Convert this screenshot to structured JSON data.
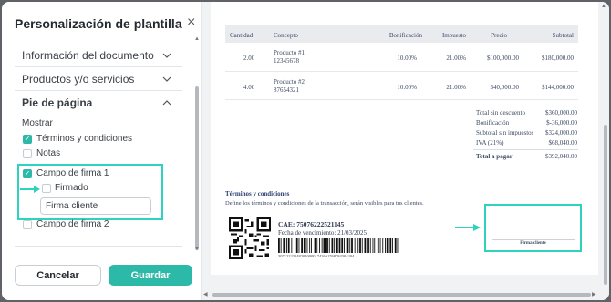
{
  "panel": {
    "title": "Personalización de plantilla",
    "close": "×",
    "sections": [
      {
        "label": "Información del documento",
        "chevron": "⌄"
      },
      {
        "label": "Productos y/o servicios",
        "chevron": "⌄"
      },
      {
        "label": "Pie de página",
        "chevron": "⌃"
      }
    ],
    "footer": {
      "heading": "Mostrar",
      "terms": "Términos y condiciones",
      "notes": "Notas",
      "sig1": "Campo de firma 1",
      "signed": "Firmado",
      "sig_input_value": "Firma cliente",
      "sig2": "Campo de firma 2"
    },
    "cancel_label": "Cancelar",
    "save_label": "Guardar"
  },
  "invoice": {
    "headers": {
      "qty": "Cantidad",
      "concept": "Concepto",
      "discount": "Bonificación",
      "tax": "Impuesto",
      "price": "Precio",
      "subtotal": "Subtotal"
    },
    "rows": [
      {
        "qty": "2.00",
        "name": "Producto #1",
        "code": "12345678",
        "discount": "10.00%",
        "tax": "21.00%",
        "price": "$100,000.00",
        "subtotal": "$180,000.00"
      },
      {
        "qty": "4.00",
        "name": "Producto #2",
        "code": "87654321",
        "discount": "10.00%",
        "tax": "21.00%",
        "price": "$40,000.00",
        "subtotal": "$144,000.00"
      }
    ],
    "totals": [
      {
        "label": "Total sin descuento",
        "value": "$360,000.00",
        "bold": false
      },
      {
        "label": "Bonificación",
        "value": "$-36,000.00",
        "bold": false
      },
      {
        "label": "Subtotal sin impuestos",
        "value": "$324,000.00",
        "bold": false
      },
      {
        "label": "IVA (21%)",
        "value": "$68,040.00",
        "bold": false
      },
      {
        "label": "Total a pagar",
        "value": "$392,040.00",
        "bold": true
      }
    ],
    "terms_title": "Términos y condiciones",
    "terms_text": "Define los términos y condiciones de la transacción, serán visibles para tus clientes.",
    "cae": "CAE: 75076222521145",
    "due": "Fecha de vencimiento: 21/03/2025",
    "barcode_number": "3071222324820100001742661768784304204",
    "signature_label": "Firma cliente"
  },
  "colors": {
    "accent": "#2cb9a8",
    "highlight": "#2ed3bd",
    "invoice_text": "#3c4a63"
  }
}
